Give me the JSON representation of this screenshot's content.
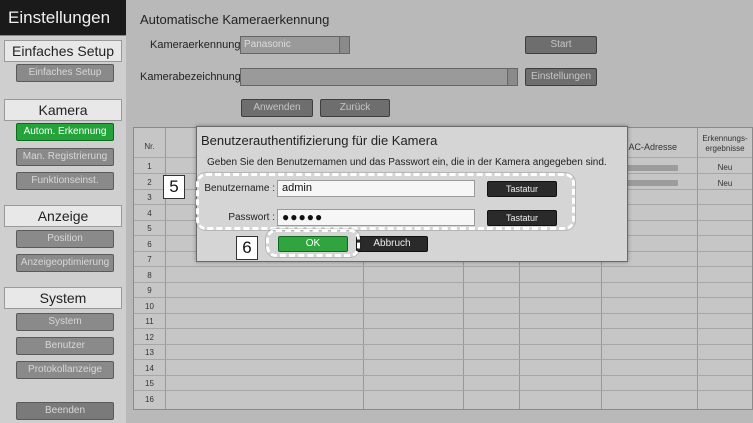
{
  "sidebar": {
    "app_title": "Einstellungen",
    "sections": [
      {
        "header": "Einfaches Setup",
        "items": [
          "Einfaches Setup"
        ]
      },
      {
        "header": "Kamera",
        "items": [
          "Autom. Erkennung",
          "Man. Registrierung",
          "Funktionseinst."
        ]
      },
      {
        "header": "Anzeige",
        "items": [
          "Position",
          "Anzeigeoptimierung"
        ]
      },
      {
        "header": "System",
        "items": [
          "System",
          "Benutzer",
          "Protokollanzeige"
        ]
      }
    ],
    "exit_label": "Beenden",
    "active_item": "Autom. Erkennung"
  },
  "main": {
    "title": "Automatische Kameraerkennung",
    "camera_detection_label": "Kameraerkennung",
    "camera_detection_value": "Panasonic",
    "start_label": "Start",
    "camera_name_label": "Kamerabezeichnung",
    "camera_name_value": "",
    "settings_label": "Einstellungen",
    "apply_label": "Anwenden",
    "back_label": "Zurück"
  },
  "table": {
    "headers": {
      "nr": "Nr.",
      "mac": "MAC-Adresse",
      "result": "Erkennungs-\nergebnisse"
    },
    "rows": [
      "1",
      "2",
      "3",
      "4",
      "5",
      "6",
      "7",
      "8",
      "9",
      "10",
      "11",
      "12",
      "13",
      "14",
      "15",
      "16"
    ],
    "results": [
      "Neu",
      "Neu"
    ]
  },
  "dialog": {
    "title": "Benutzerauthentifizierung für die Kamera",
    "message": "Geben Sie den Benutzernamen und das Passwort ein, die in der Kamera angegeben sind.",
    "username_label": "Benutzername :",
    "username_value": "admin",
    "password_label": "Passwort :",
    "password_value": "●●●●●",
    "keyboard_label": "Tastatur",
    "ok_label": "OK",
    "cancel_label": "Abbruch"
  },
  "callouts": {
    "fields": "5",
    "ok": "6"
  },
  "colors": {
    "active_green": "#23a33a",
    "dark_button": "#2a2a2a",
    "title_bar": "#1a1a1a"
  }
}
